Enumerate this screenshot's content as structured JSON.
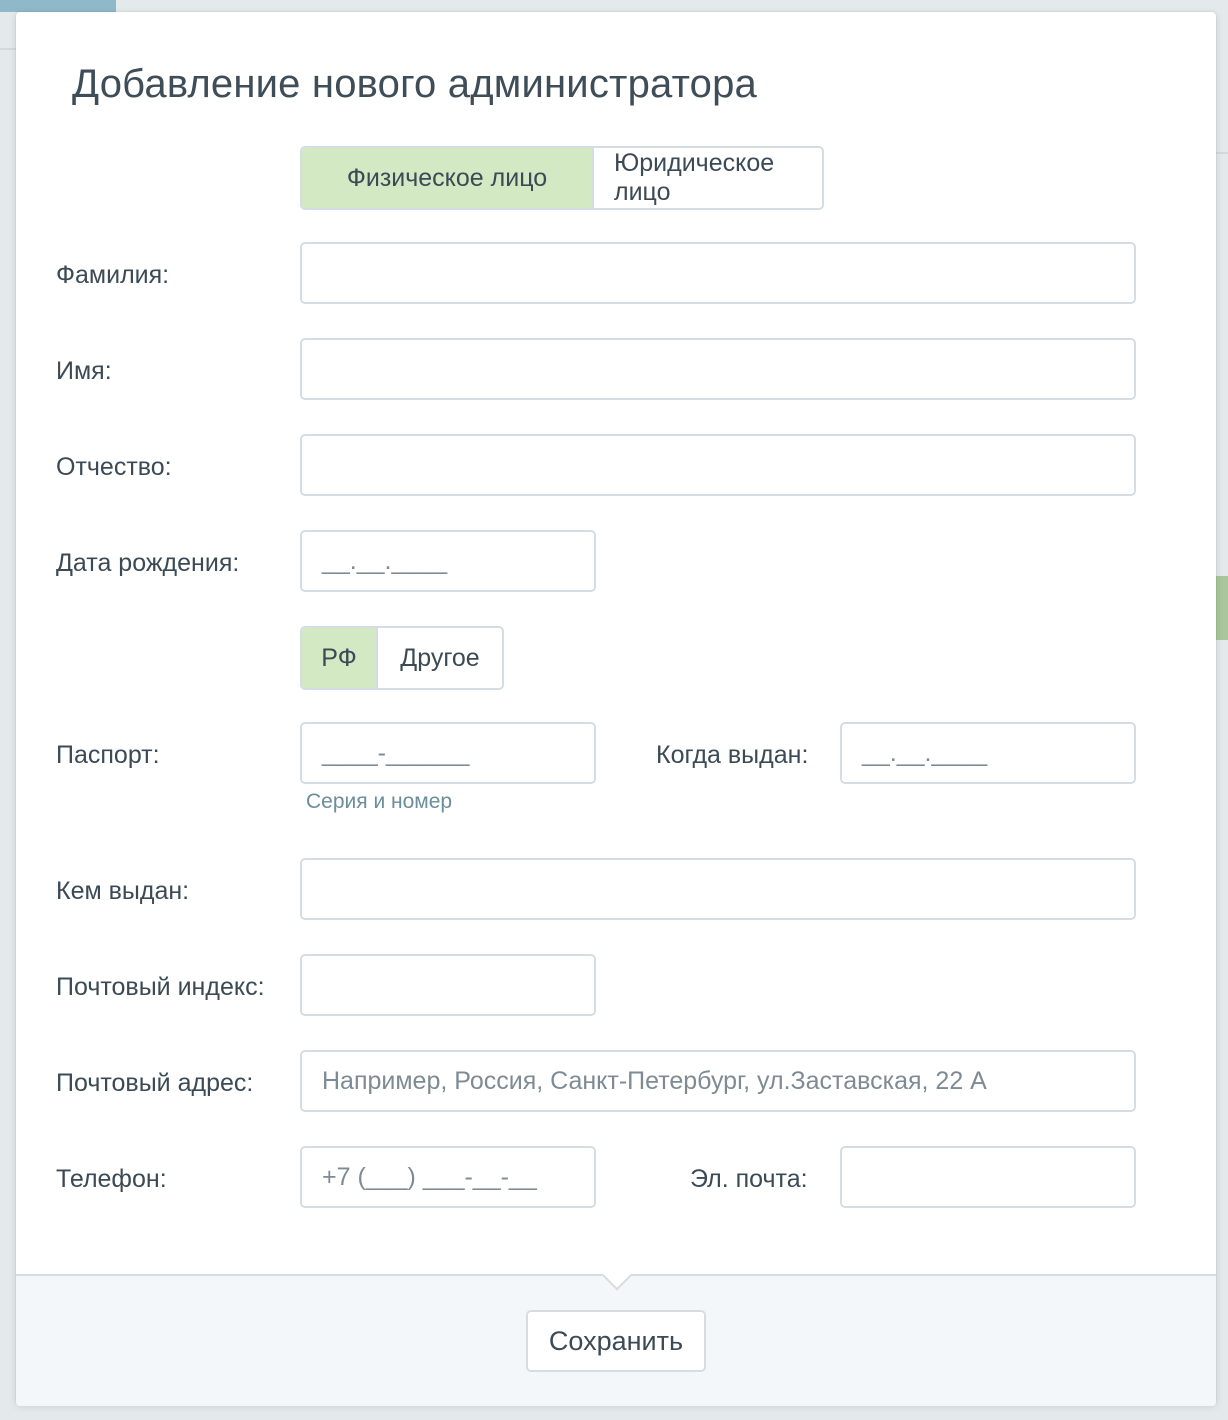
{
  "modal": {
    "title": "Добавление нового администратора",
    "close_label": "×"
  },
  "person_type": {
    "options": [
      "Физическое лицо",
      "Юридическое лицо"
    ],
    "selected": "Физическое лицо"
  },
  "fields": {
    "last_name": {
      "label": "Фамилия:",
      "value": ""
    },
    "first_name": {
      "label": "Имя:",
      "value": ""
    },
    "patronymic": {
      "label": "Отчество:",
      "value": ""
    },
    "birth_date": {
      "label": "Дата рождения:",
      "mask": "__.__.____"
    },
    "passport": {
      "label": "Паспорт:",
      "mask": "____-______",
      "hint": "Серия и номер"
    },
    "issued_date": {
      "label": "Когда выдан:",
      "mask": "__.__.____"
    },
    "issued_by": {
      "label": "Кем выдан:",
      "value": ""
    },
    "postal_code": {
      "label": "Почтовый индекс:",
      "value": ""
    },
    "postal_address": {
      "label": "Почтовый адрес:",
      "placeholder": "Например, Россия, Санкт-Петербург, ул.Заставская, 22 А"
    },
    "phone": {
      "label": "Телефон:",
      "mask": "+7 (___) ___-__-__"
    },
    "email": {
      "label": "Эл. почта:",
      "value": ""
    }
  },
  "citizenship": {
    "options": [
      "РФ",
      "Другое"
    ],
    "selected": "РФ"
  },
  "footer": {
    "save_label": "Сохранить"
  },
  "colors": {
    "active_segment": "#d2e9c4",
    "border": "#d5dde2",
    "hint_text": "#6a8e9a",
    "footer_bg": "#f3f7f9"
  }
}
